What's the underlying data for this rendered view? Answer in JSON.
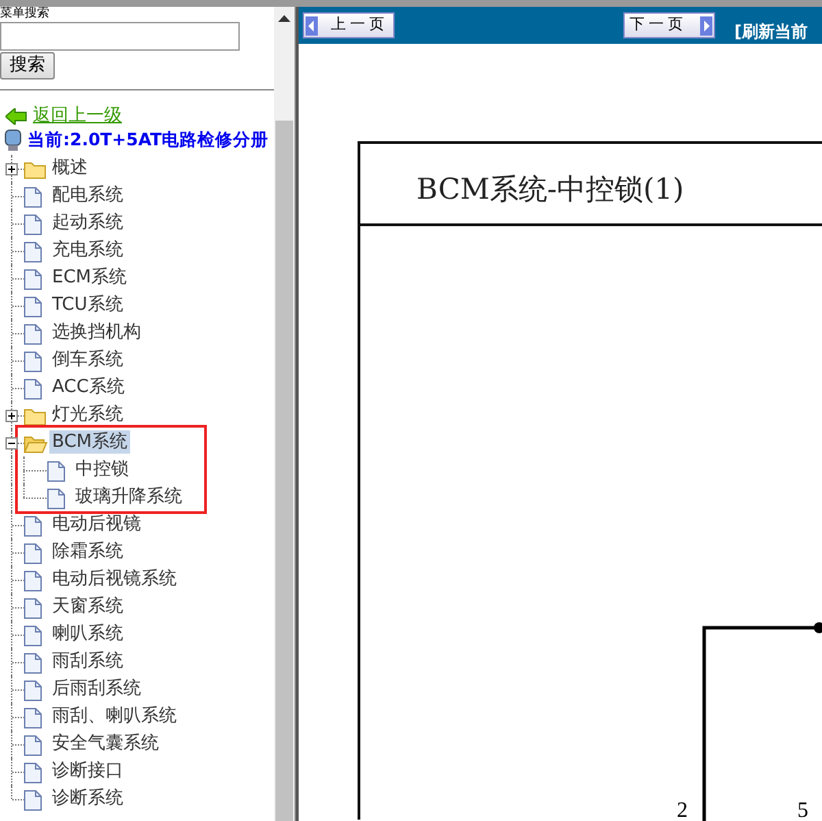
{
  "search": {
    "label": "菜单搜索",
    "button": "搜索"
  },
  "back_link": "返回上一级",
  "current": "当前:2.0T+5AT电路检修分册",
  "tree": [
    {
      "kind": "folder",
      "label": "概述",
      "expanded": false,
      "selected": false
    },
    {
      "kind": "doc",
      "label": "配电系统",
      "selected": false
    },
    {
      "kind": "doc",
      "label": "起动系统",
      "selected": false
    },
    {
      "kind": "doc",
      "label": "充电系统",
      "selected": false
    },
    {
      "kind": "doc",
      "label": "ECM系统",
      "selected": false
    },
    {
      "kind": "doc",
      "label": "TCU系统",
      "selected": false
    },
    {
      "kind": "doc",
      "label": "选换挡机构",
      "selected": false
    },
    {
      "kind": "doc",
      "label": "倒车系统",
      "selected": false
    },
    {
      "kind": "doc",
      "label": "ACC系统",
      "selected": false
    },
    {
      "kind": "folder",
      "label": "灯光系统",
      "expanded": false,
      "selected": false
    },
    {
      "kind": "folder",
      "label": "BCM系统",
      "expanded": true,
      "selected": true,
      "annotated": true,
      "children": [
        {
          "kind": "doc",
          "label": "中控锁",
          "selected": false
        },
        {
          "kind": "doc",
          "label": "玻璃升降系统",
          "selected": false
        }
      ]
    },
    {
      "kind": "doc",
      "label": "电动后视镜",
      "selected": false
    },
    {
      "kind": "doc",
      "label": "除霜系统",
      "selected": false
    },
    {
      "kind": "doc",
      "label": "电动后视镜系统",
      "selected": false
    },
    {
      "kind": "doc",
      "label": "天窗系统",
      "selected": false
    },
    {
      "kind": "doc",
      "label": "喇叭系统",
      "selected": false
    },
    {
      "kind": "doc",
      "label": "雨刮系统",
      "selected": false
    },
    {
      "kind": "doc",
      "label": "后雨刮系统",
      "selected": false
    },
    {
      "kind": "doc",
      "label": "雨刮、喇叭系统",
      "selected": false
    },
    {
      "kind": "doc",
      "label": "安全气囊系统",
      "selected": false
    },
    {
      "kind": "doc",
      "label": "诊断接口",
      "selected": false
    },
    {
      "kind": "doc",
      "label": "诊断系统",
      "selected": false
    }
  ],
  "toolbar": {
    "prev": "上一页",
    "next": "下一页",
    "refresh": "[刷新当前"
  },
  "diagram": {
    "title": "BCM系统-中控锁(1)",
    "pin_labels": [
      "2",
      "5"
    ]
  }
}
